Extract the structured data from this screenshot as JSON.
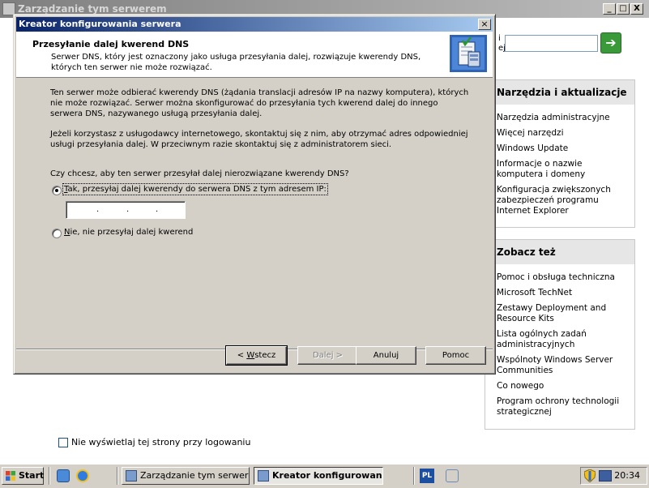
{
  "background_window": {
    "title": "Zarządzanie tym serwerem",
    "controls": {
      "minimize": "_",
      "maximize": "□",
      "close": "X"
    },
    "search": {
      "label_top": "i",
      "label_bottom": "ej",
      "value": "",
      "go_icon": "arrow-right-icon"
    },
    "tools_panel": {
      "heading": "Narzędzia i aktualizacje",
      "items": [
        "Narzędzia administracyjne",
        "Więcej narzędzi",
        "Windows Update",
        "Informacje o nazwie komputera i domeny",
        "Konfiguracja zwiększonych zabezpieczeń programu Internet Explorer"
      ]
    },
    "see_also_panel": {
      "heading": "Zobacz też",
      "items": [
        "Pomoc i obsługa techniczna",
        "Microsoft TechNet",
        "Zestawy Deployment and Resource Kits",
        "Lista ogólnych zadań administracyjnych",
        "Wspólnoty Windows Server Communities",
        "Co nowego",
        "Program ochrony technologii strategicznej"
      ]
    },
    "dont_show_checkbox": {
      "label": "Nie wyświetlaj tej strony przy logowaniu",
      "checked": false
    }
  },
  "dialog": {
    "title": "Kreator konfigurowania serwera",
    "close_label": "×",
    "header": {
      "title": "Przesyłanie dalej kwerend DNS",
      "description": "Serwer DNS, który jest oznaczony jako usługa przesyłania dalej, rozwiązuje kwerendy DNS, których ten serwer nie może rozwiązać."
    },
    "paragraph1": "Ten serwer może odbierać kwerendy DNS (żądania translacji adresów IP na nazwy komputera), których nie może rozwiązać. Serwer można skonfigurować do przesyłania tych kwerend dalej do innego serwera DNS, nazywanego usługą przesyłania dalej.",
    "paragraph2": "Jeżeli korzystasz z usługodawcy internetowego, skontaktuj się z nim, aby otrzymać adres odpowiedniej usługi przesyłania dalej. W przeciwnym razie skontaktuj się z administratorem sieci.",
    "question": "Czy chcesz, aby ten serwer przesyłał dalej nierozwiązane kwerendy DNS?",
    "option_yes": {
      "accel": "T",
      "rest": "ak, przesyłaj dalej kwerendy do serwera DNS z tym adresem IP:",
      "selected": true
    },
    "ip_address": {
      "value": "",
      "separators": [
        ".",
        ".",
        "."
      ]
    },
    "option_no": {
      "accel": "N",
      "rest": "ie, nie przesyłaj dalej kwerend",
      "selected": false
    },
    "buttons": {
      "back": {
        "prefix": "< ",
        "accel": "W",
        "rest": "stecz",
        "enabled": true
      },
      "next": {
        "label": "Dalej >",
        "enabled": false
      },
      "cancel": {
        "label": "Anuluj",
        "enabled": true
      },
      "help": {
        "label": "Pomoc",
        "enabled": true
      }
    }
  },
  "taskbar": {
    "start_label": "Start",
    "quick_launch": [
      "ie-shortcut-icon",
      "ie-browser-icon"
    ],
    "tasks": [
      {
        "label": "Zarządzanie tym serwerem",
        "active": false
      },
      {
        "label": "Kreator konfigurowan...",
        "active": true
      }
    ],
    "language": "PL",
    "clock": "20:34"
  },
  "colors": {
    "dialog_title_start": "#0a246a",
    "dialog_title_end": "#a6caf0",
    "inactive_title": "#7f7f7f",
    "face": "#d4d0c8",
    "panel_heading_bg": "#e6e6e6"
  }
}
